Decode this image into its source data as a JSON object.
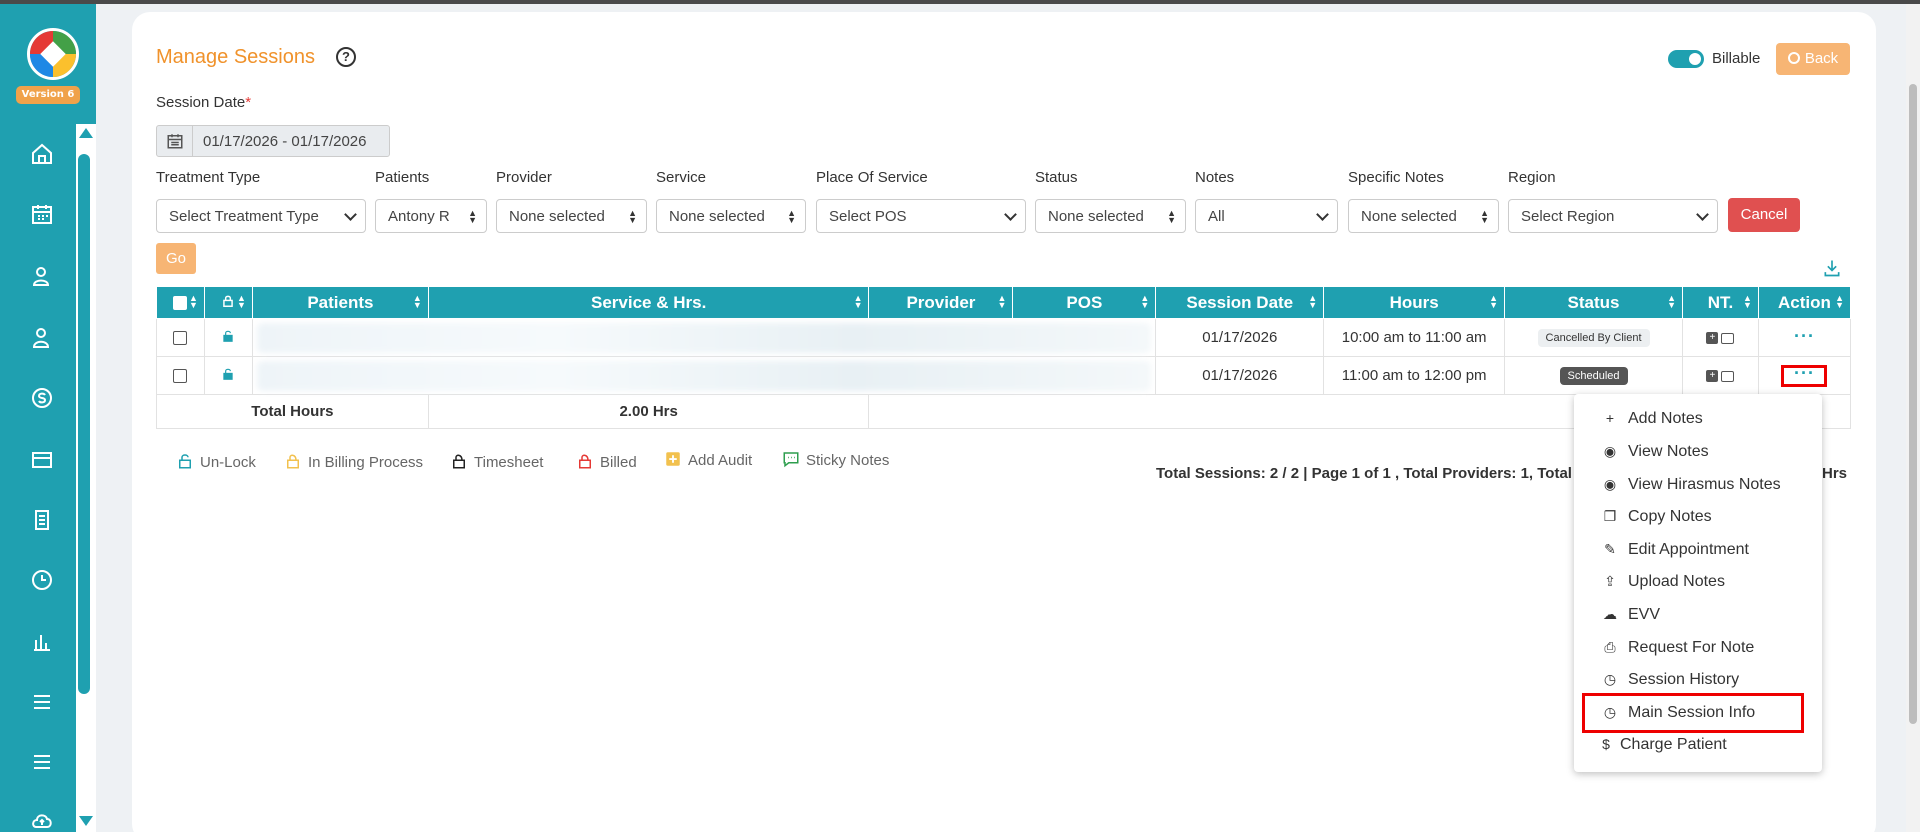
{
  "sidebar": {
    "version_badge": "Version 6",
    "icons": [
      "home-icon",
      "calendar-icon",
      "user-icon",
      "users-icon",
      "billing-icon",
      "card-icon",
      "document-icon",
      "clock-icon",
      "chart-icon",
      "menu-icon",
      "list-icon",
      "upload-icon"
    ]
  },
  "header": {
    "title": "Manage Sessions",
    "billable_label": "Billable",
    "back_label": "Back"
  },
  "filters": {
    "session_date_label": "Session Date",
    "session_date_required": "*",
    "session_date_value": "01/17/2026 - 01/17/2026",
    "treatment_type": {
      "label": "Treatment Type",
      "value": "Select Treatment Type"
    },
    "patients": {
      "label": "Patients",
      "value": "Antony R"
    },
    "provider": {
      "label": "Provider",
      "value": "None selected"
    },
    "service": {
      "label": "Service",
      "value": "None selected"
    },
    "place_of_service": {
      "label": "Place Of Service",
      "value": "Select POS"
    },
    "status": {
      "label": "Status",
      "value": "None selected"
    },
    "notes": {
      "label": "Notes",
      "value": "All"
    },
    "specific_notes": {
      "label": "Specific Notes",
      "value": "None selected"
    },
    "region": {
      "label": "Region",
      "value": "Select Region"
    },
    "cancel_label": "Cancel",
    "go_label": "Go"
  },
  "table": {
    "columns": [
      "Patients",
      "Service & Hrs.",
      "Provider",
      "POS",
      "Session Date",
      "Hours",
      "Status",
      "NT.",
      "Action"
    ],
    "rows": [
      {
        "session_date": "01/17/2026",
        "hours": "10:00 am to 11:00 am",
        "status": "Cancelled By Client"
      },
      {
        "session_date": "01/17/2026",
        "hours": "11:00 am to 12:00 pm",
        "status": "Scheduled"
      }
    ],
    "total_label": "Total Hours",
    "total_value": "2.00 Hrs"
  },
  "legend": {
    "unlock": "Un-Lock",
    "billing": "In Billing Process",
    "timesheet": "Timesheet",
    "billed": "Billed",
    "add_audit": "Add Audit",
    "sticky_notes": "Sticky Notes"
  },
  "footer": {
    "stats": "Total Sessions: 2 / 2 | Page 1 of 1 , Total Providers: 1, Total Pa",
    "hrs_tail": "Hrs"
  },
  "action_menu": {
    "items": [
      {
        "label": "Add Notes",
        "icon": "plus-icon"
      },
      {
        "label": "View Notes",
        "icon": "eye-icon"
      },
      {
        "label": "View Hirasmus Notes",
        "icon": "eye-icon"
      },
      {
        "label": "Copy Notes",
        "icon": "copy-icon"
      },
      {
        "label": "Edit Appointment",
        "icon": "pencil-icon"
      },
      {
        "label": "Upload Notes",
        "icon": "upload-file-icon"
      },
      {
        "label": "EVV",
        "icon": "cloud-upload-icon"
      },
      {
        "label": "Request For Note",
        "icon": "file-request-icon"
      },
      {
        "label": "Session History",
        "icon": "clock-icon"
      },
      {
        "label": "Main Session Info",
        "icon": "clock-icon"
      },
      {
        "label": "Charge Patient",
        "icon": "dollar-icon"
      }
    ]
  },
  "colors": {
    "brand_teal": "#1fa0b0",
    "accent_orange": "#f0922b",
    "cancel_red": "#e05050",
    "highlight_red": "#ee0000"
  }
}
